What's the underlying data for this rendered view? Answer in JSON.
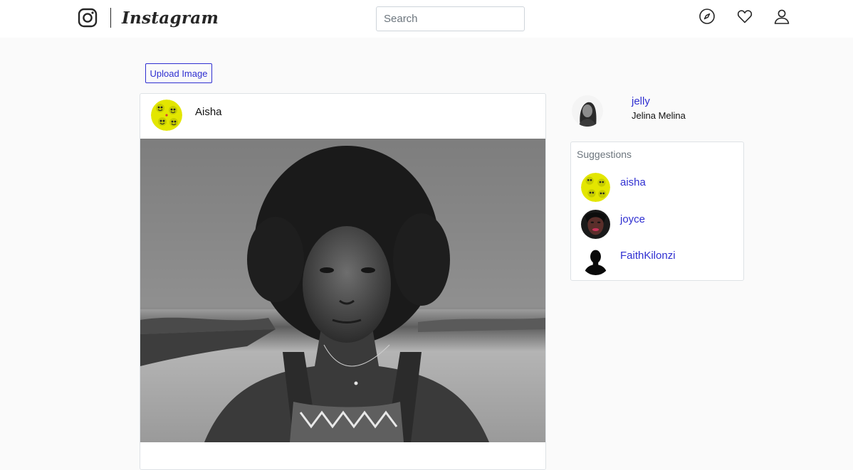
{
  "nav": {
    "brand": "Instagram",
    "search_placeholder": "Search",
    "icons": [
      "instagram-glyph-icon",
      "compass-icon",
      "heart-icon",
      "user-icon"
    ]
  },
  "upload": {
    "label": "Upload Image",
    "accent": "#2f2fd1"
  },
  "post": {
    "author": "Aisha",
    "avatar_icon": "yellow-emoji-avatar",
    "image": "black-and-white-portrait"
  },
  "current_user": {
    "username": "jelly",
    "full_name": "Jelina Melina"
  },
  "suggestions": {
    "title": "Suggestions",
    "items": [
      {
        "username": "aisha",
        "avatar": "yellow-emoji-avatar"
      },
      {
        "username": "joyce",
        "avatar": "portrait-avatar"
      },
      {
        "username": "FaithKilonzi",
        "avatar": "silhouette-avatar"
      }
    ]
  },
  "colors": {
    "link": "#2f2fd1",
    "background": "#fafafa",
    "nav": "#ffffff"
  }
}
